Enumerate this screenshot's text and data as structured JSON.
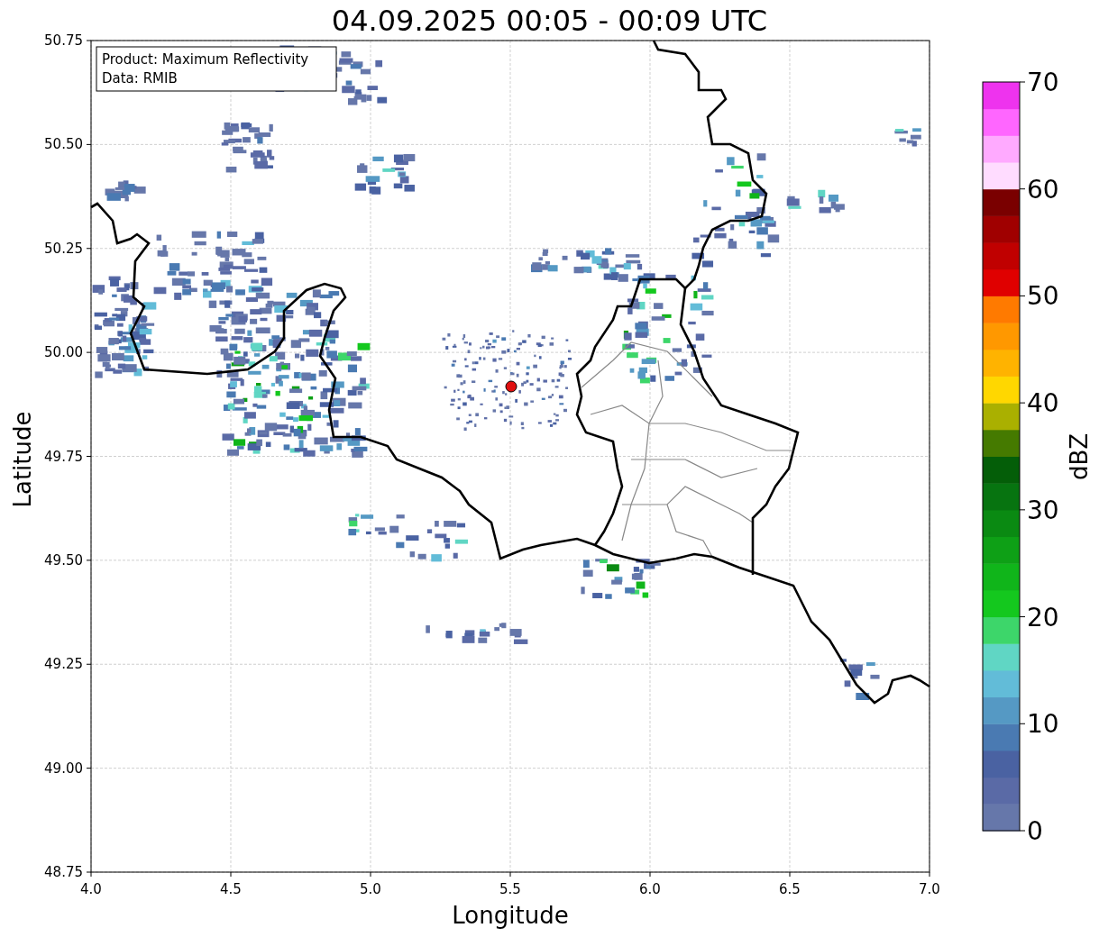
{
  "title": "04.09.2025 00:05 - 00:09 UTC",
  "plot": {
    "xlabel": "Longitude",
    "ylabel": "Latitude",
    "xticks": [
      "4.0",
      "4.5",
      "5.0",
      "5.5",
      "6.0",
      "6.5",
      "7.0"
    ],
    "yticks": [
      "50.75",
      "50.50",
      "50.25",
      "50.00",
      "49.75",
      "49.50",
      "49.25",
      "49.00",
      "48.75"
    ],
    "info_box": [
      "Product: Maximum Reflectivity",
      "Data: RMIB"
    ]
  },
  "colorbar": {
    "label": "dBZ",
    "ticks": [
      "70",
      "60",
      "50",
      "40",
      "30",
      "20",
      "10",
      "0"
    ],
    "bands": [
      {
        "color": "#6677aa"
      },
      {
        "color": "#5a6aa6"
      },
      {
        "color": "#4a62a2"
      },
      {
        "color": "#4a7ab2"
      },
      {
        "color": "#5599c4"
      },
      {
        "color": "#62bcd8"
      },
      {
        "color": "#60d6c4"
      },
      {
        "color": "#3dd66a"
      },
      {
        "color": "#14c81e"
      },
      {
        "color": "#10b51a"
      },
      {
        "color": "#0ea016"
      },
      {
        "color": "#0a8a12"
      },
      {
        "color": "#077410"
      },
      {
        "color": "#045e08"
      },
      {
        "color": "#457a00"
      },
      {
        "color": "#aab000"
      },
      {
        "color": "#ffd700"
      },
      {
        "color": "#ffb300"
      },
      {
        "color": "#ff9800"
      },
      {
        "color": "#ff7a00"
      },
      {
        "color": "#e00000"
      },
      {
        "color": "#c00000"
      },
      {
        "color": "#a00000"
      },
      {
        "color": "#7a0000"
      },
      {
        "color": "#ffdcff"
      },
      {
        "color": "#ffaaff"
      },
      {
        "color": "#ff66ff"
      },
      {
        "color": "#ee33ee"
      }
    ]
  }
}
